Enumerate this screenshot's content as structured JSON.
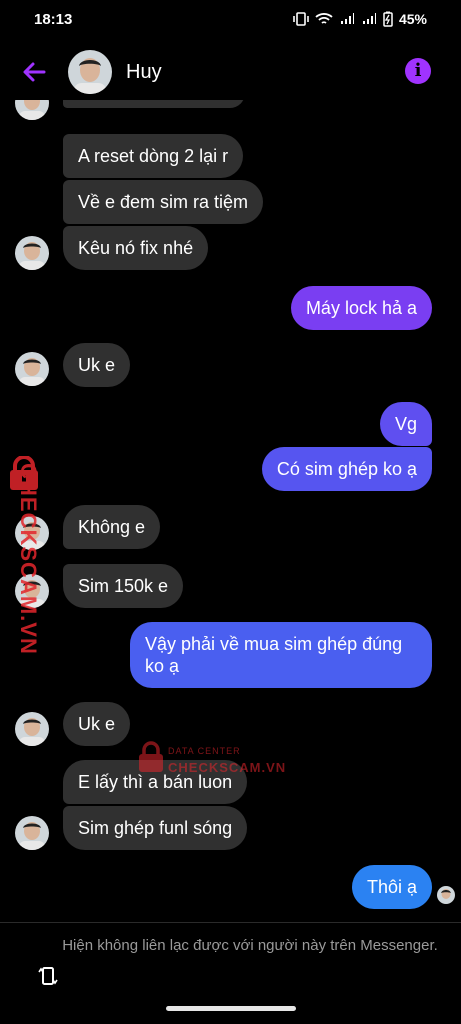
{
  "status": {
    "time": "18:13",
    "battery": "45%"
  },
  "contact": {
    "name": "Huy"
  },
  "messages": [
    {
      "text": "A reset dòng 2 lại r"
    },
    {
      "text": "Về e đem sim ra tiệm"
    },
    {
      "text": "Kêu nó fix nhé"
    },
    {
      "text": "Máy lock hả a"
    },
    {
      "text": "Uk e"
    },
    {
      "text": "Vg"
    },
    {
      "text": "Có sim ghép ko ạ"
    },
    {
      "text": "Không e"
    },
    {
      "text": "Sim 150k e"
    },
    {
      "text": "Vậy phải về mua sim ghép đúng ko ạ"
    },
    {
      "text": "Uk e"
    },
    {
      "text": "E lấy thì a bán luon"
    },
    {
      "text": "Sim ghép funl sóng"
    },
    {
      "text": "Thôi ạ"
    }
  ],
  "footer": {
    "notice": "Hiện không liên lạc được với người này trên Messenger."
  },
  "watermark": {
    "small": "DATA CENTER",
    "big": "CHECKSCAM.VN"
  },
  "colors": {
    "accent": "#a033ff",
    "incoming": "#303030"
  }
}
